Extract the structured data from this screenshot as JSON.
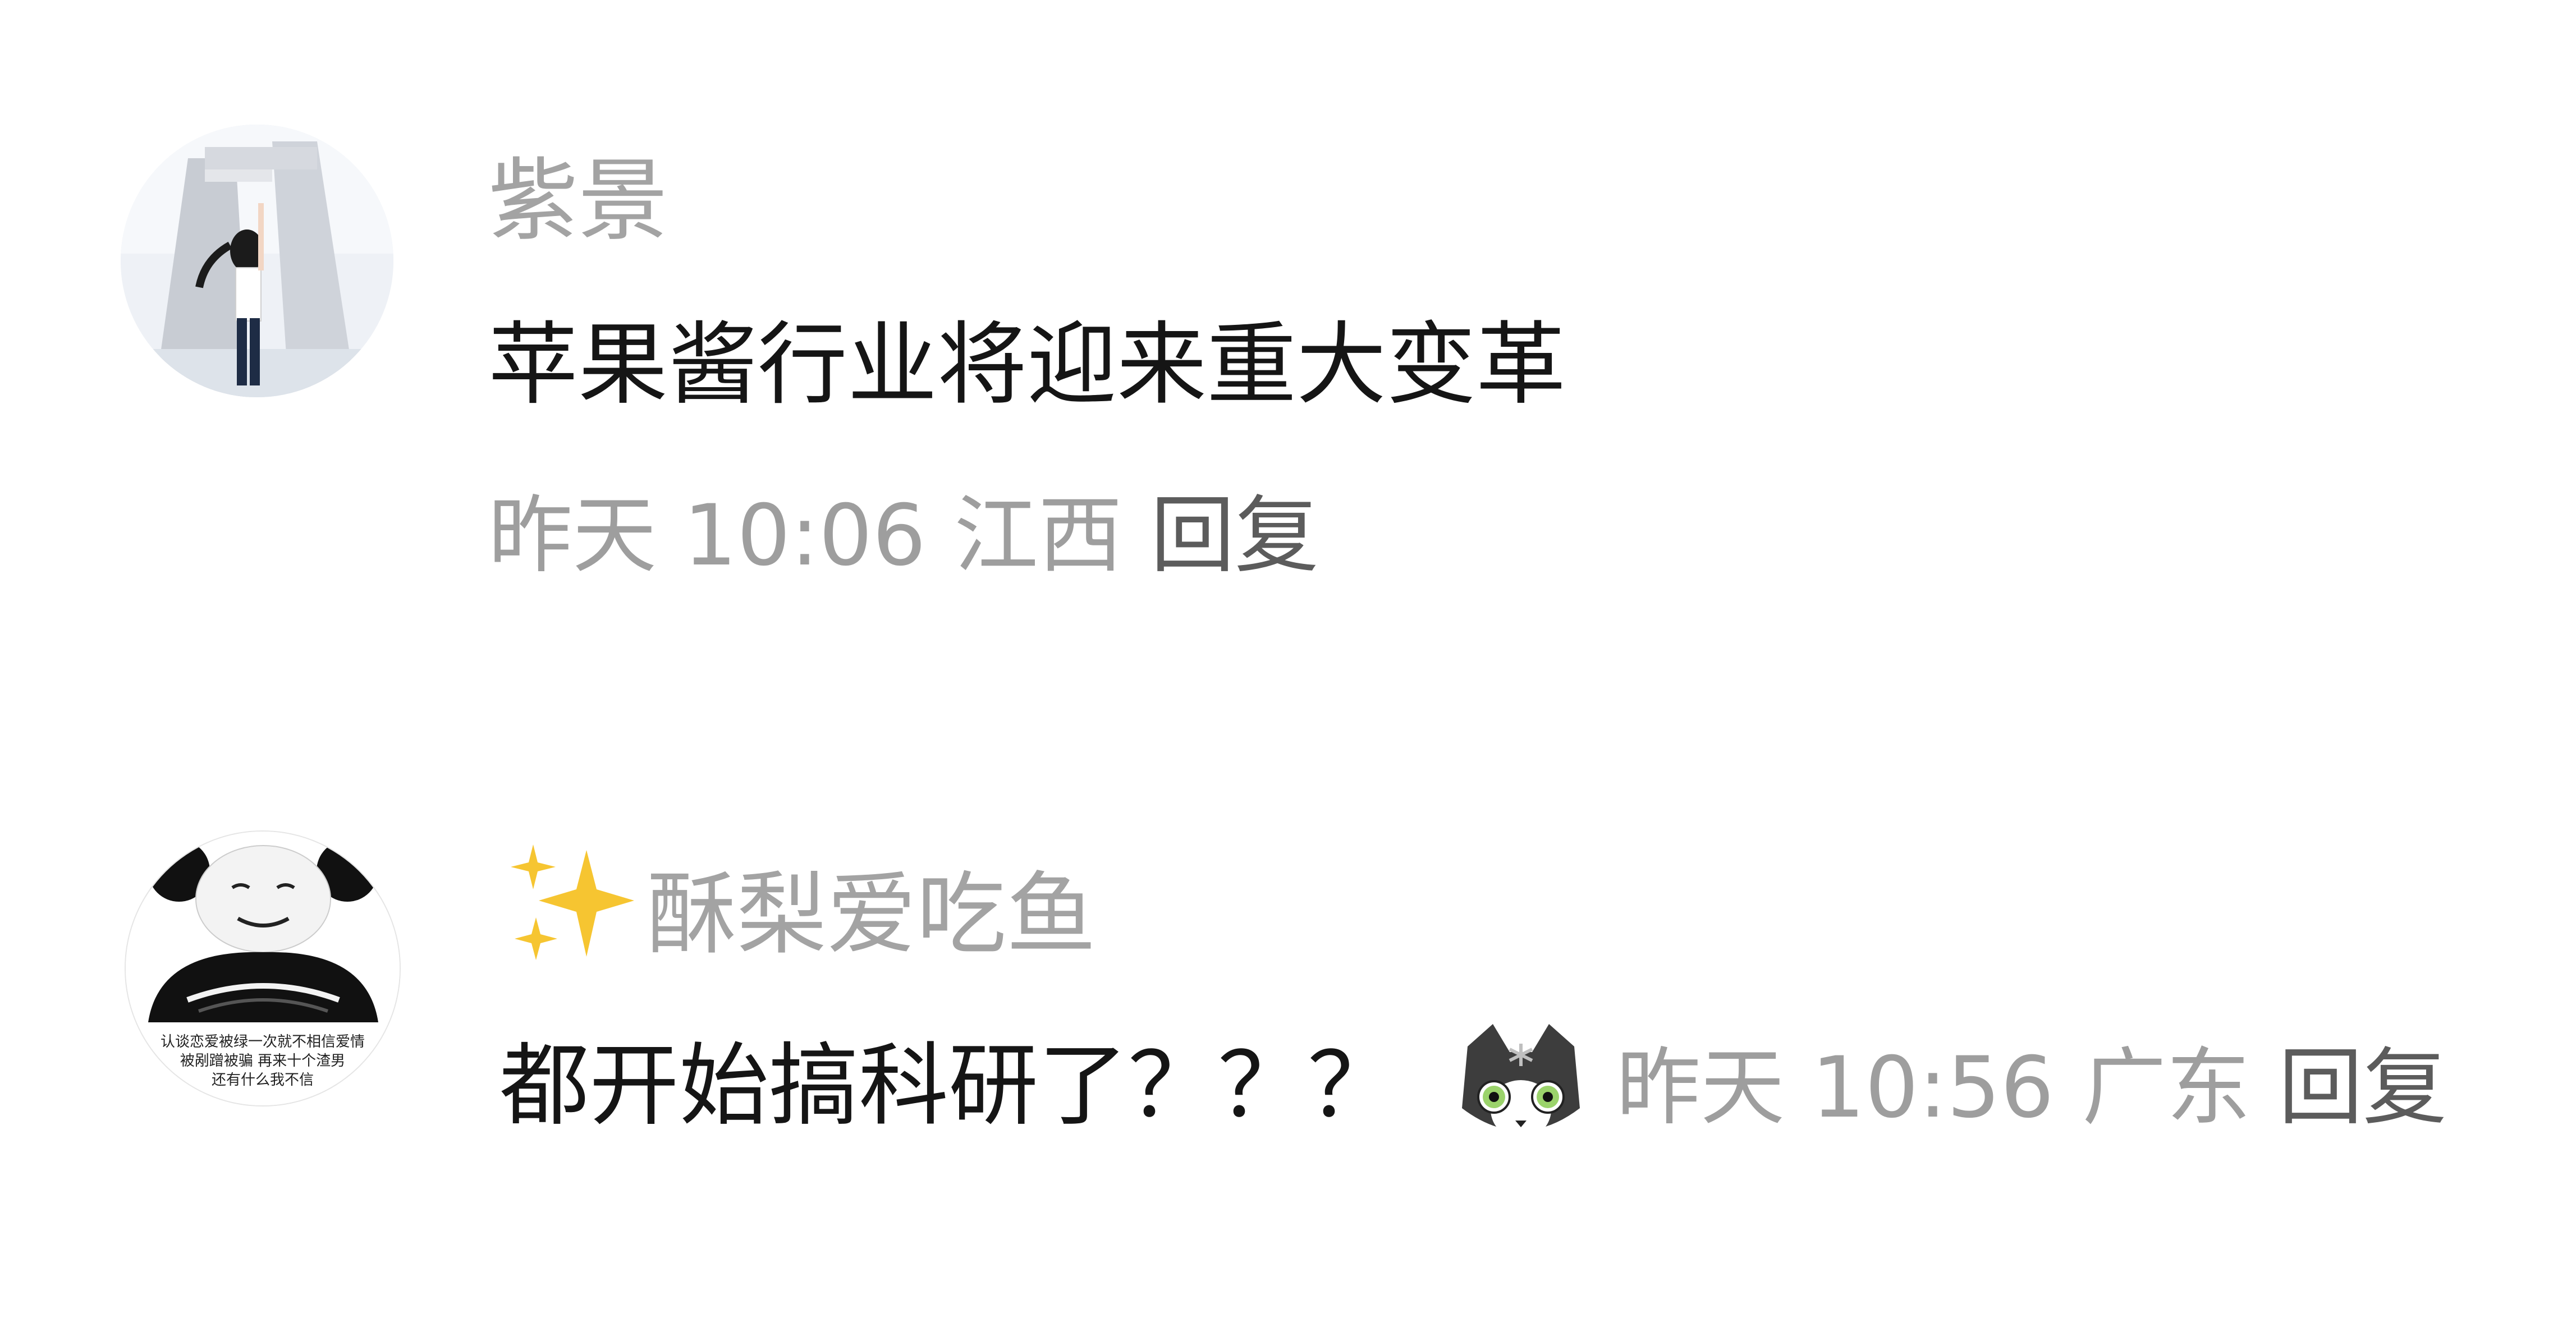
{
  "comments": [
    {
      "username": "紫景",
      "text": "苹果酱行业将迎来重大变革",
      "time": "昨天 10:06",
      "location": "江西",
      "reply_label": "回复",
      "avatar_icon": "girl-photo-avatar"
    },
    {
      "username_prefix_icon": "sparkles-icon",
      "username": "酥梨爱吃鱼",
      "text": "都开始搞科研了？？？",
      "emoji_icon": "cat-face-emoji",
      "time": "昨天 10:56",
      "location": "广东",
      "reply_label": "回复",
      "avatar_icon": "panda-meme-avatar",
      "avatar_caption_lines": [
        "认谈恋爱被绿一次就不相信爱情",
        "被剐蹭被骗",
        "再来十个渣男",
        "还有什么我不信"
      ]
    }
  ],
  "colors": {
    "background": "#ffffff",
    "username": "#a3a3a3",
    "text": "#151515",
    "meta": "#9e9e9e",
    "reply": "#5c5c5c",
    "sparkle": "#f6c531"
  }
}
